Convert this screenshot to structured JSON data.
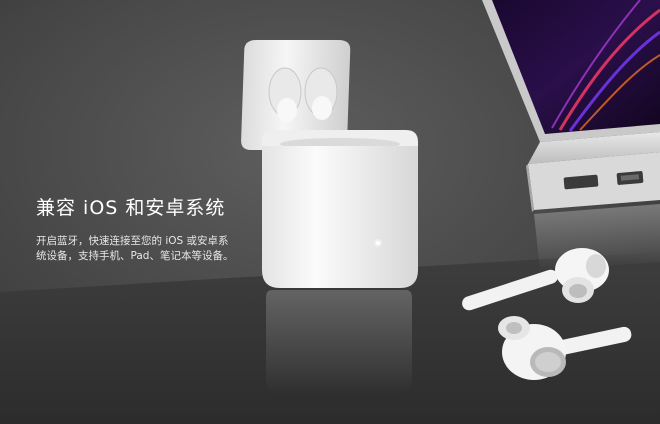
{
  "headline": "兼容 iOS 和安卓系统",
  "body_lines": [
    "开启蓝牙，快速连接至您的 iOS 或安卓系",
    "统设备，支持手机、Pad、笔记本等设备。"
  ],
  "colors": {
    "background": "#4a4a4a",
    "text": "#ffffff",
    "product": "#f4f4f4"
  }
}
